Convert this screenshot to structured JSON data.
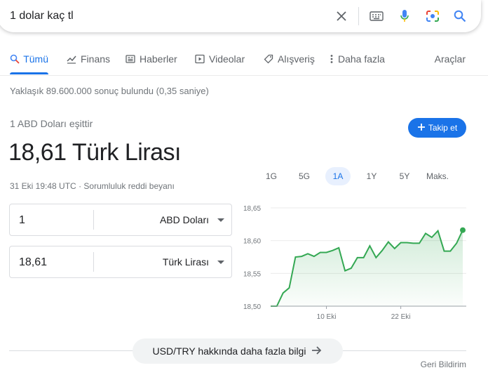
{
  "search": {
    "query": "1 dolar kaç tl"
  },
  "tabs": [
    {
      "label": "Tümü",
      "icon": "search-icon",
      "active": true
    },
    {
      "label": "Finans",
      "icon": "finance-icon"
    },
    {
      "label": "Haberler",
      "icon": "news-icon"
    },
    {
      "label": "Videolar",
      "icon": "video-icon"
    },
    {
      "label": "Alışveriş",
      "icon": "tag-icon"
    },
    {
      "label": "Daha fazla",
      "icon": "more-vert-icon"
    }
  ],
  "tools_label": "Araçlar",
  "result_stats": "Yaklaşık 89.600.000 sonuç bulundu (0,35 saniye)",
  "converter": {
    "equals_label": "1 ABD Doları eşittir",
    "result": "18,61 Türk Lirası",
    "timestamp": "31 Eki 19:48 UTC",
    "separator": "·",
    "disclaimer": "Sorumluluk reddi beyanı",
    "follow_label": "Takip et",
    "from": {
      "value": "1",
      "unit": "ABD Doları"
    },
    "to": {
      "value": "18,61",
      "unit": "Türk Lirası"
    }
  },
  "ranges": [
    {
      "label": "1G"
    },
    {
      "label": "5G"
    },
    {
      "label": "1A",
      "active": true
    },
    {
      "label": "1Y"
    },
    {
      "label": "5Y"
    },
    {
      "label": "Maks."
    }
  ],
  "chart_data": {
    "type": "area",
    "yticks": [
      "18,65",
      "18,60",
      "18,55",
      "18,50"
    ],
    "ylim": [
      18.5,
      18.65
    ],
    "xticks": [
      "10 Eki",
      "22 Eki"
    ],
    "series_color": "#34a853",
    "values": [
      18.5,
      18.5,
      18.52,
      18.528,
      18.575,
      18.576,
      18.58,
      18.576,
      18.582,
      18.582,
      18.585,
      18.589,
      18.554,
      18.558,
      18.574,
      18.574,
      18.592,
      18.574,
      18.585,
      18.598,
      18.588,
      18.597,
      18.597,
      18.596,
      18.596,
      18.611,
      18.605,
      18.615,
      18.584,
      18.584,
      18.596,
      18.616
    ]
  },
  "more_info_label": "USD/TRY hakkında daha fazla bilgi",
  "feedback_label": "Geri Bildirim",
  "colors": {
    "accent": "#1a73e8",
    "chart": "#34a853"
  }
}
